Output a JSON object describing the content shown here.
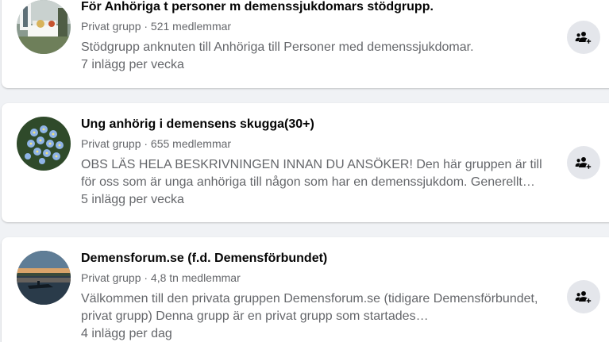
{
  "groups": [
    {
      "name": "För Anhöriga t personer m demenssjukdomars stödgrupp.",
      "meta": "Privat grupp · 521 medlemmar",
      "description": "Stödgrupp anknuten till Anhöriga till Personer med demenssjukdomar.",
      "frequency": "7 inlägg per vecka",
      "avatar": "garden-table-photo",
      "action_icon": "join-group-icon"
    },
    {
      "name": "Ung anhörig i demensens skugga(30+)",
      "meta": "Privat grupp · 655 medlemmar",
      "description": "OBS LÄS HELA BESKRIVNINGEN INNAN DU ANSÖKER! Den här gruppen är till för oss som är unga anhöriga till någon som har en demenssjukdom. Generellt…",
      "frequency": "5 inlägg per vecka",
      "avatar": "forget-me-not-flowers-photo",
      "action_icon": "join-group-icon"
    },
    {
      "name": "Demensforum.se (f.d. Demensförbundet)",
      "meta": "Privat grupp · 4,8 tn medlemmar",
      "description": "Välkommen till den privata gruppen Demensforum.se (tidigare Demensförbundet, privat grupp) Denna grupp är en privat grupp som startades…",
      "frequency": "4 inlägg per dag",
      "avatar": "lake-sunset-photo",
      "action_icon": "join-group-icon"
    }
  ],
  "colors": {
    "page_background": "#f0f2f5",
    "card_background": "#ffffff",
    "title_text": "#050505",
    "secondary_text": "#65676b",
    "button_background": "#e4e6eb"
  }
}
